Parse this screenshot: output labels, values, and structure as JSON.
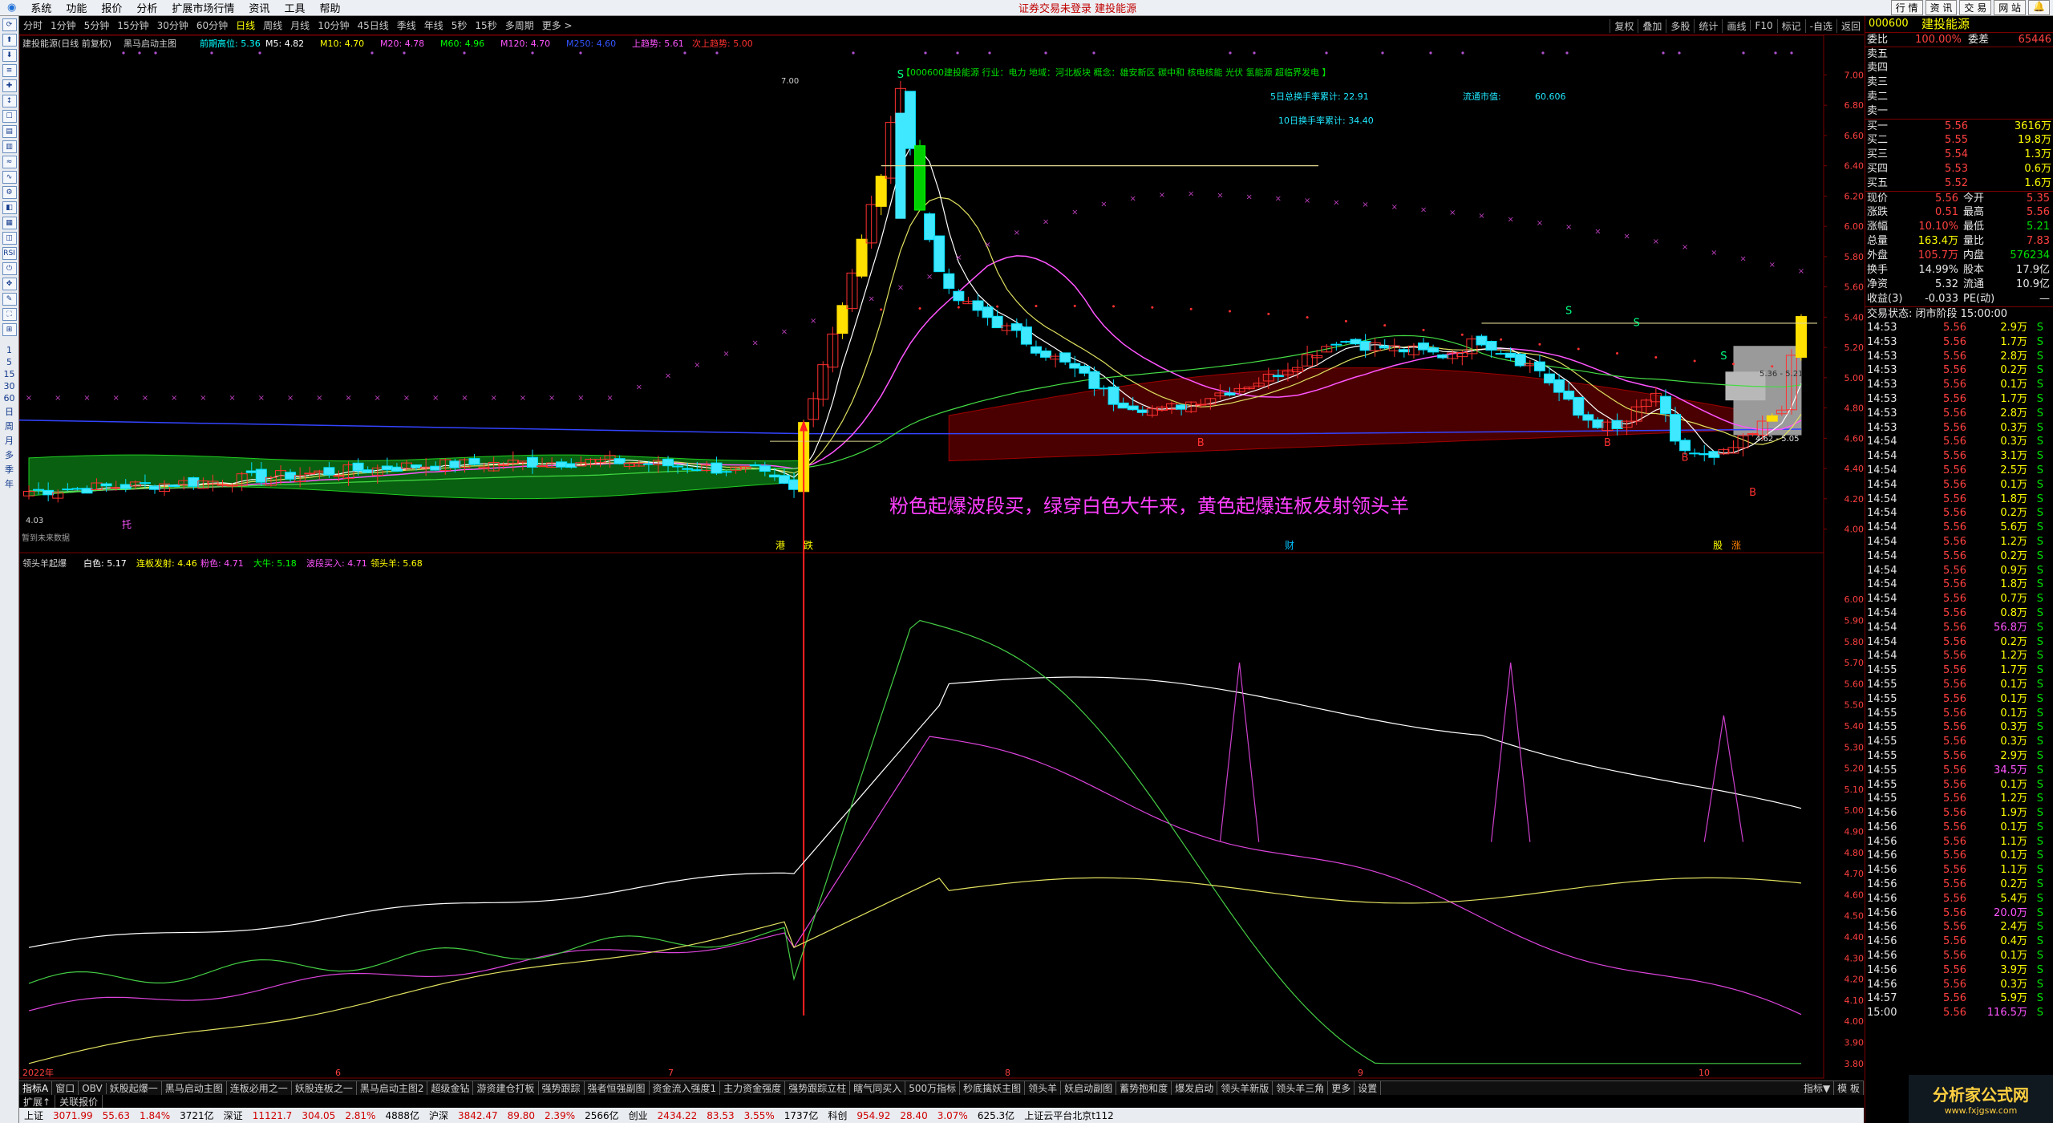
{
  "menu": {
    "items": [
      "系统",
      "功能",
      "报价",
      "分析",
      "扩展市场行情",
      "资讯",
      "工具",
      "帮助"
    ],
    "notice": "证券交易未登录  建投能源",
    "right_buttons": [
      "行 情",
      "资 讯",
      "交 易",
      "网 站",
      "🔔"
    ]
  },
  "periods": [
    "分时",
    "1分钟",
    "5分钟",
    "15分钟",
    "30分钟",
    "60分钟",
    "日线",
    "周线",
    "月线",
    "10分钟",
    "45日线",
    "季线",
    "年线",
    "5秒",
    "15秒",
    "多周期",
    "更多 >"
  ],
  "period_selected": 6,
  "period_right": [
    "复权",
    "叠加",
    "多股",
    "统计",
    "画线",
    "F10",
    "标记",
    "-自选",
    "返回"
  ],
  "left_tools": [
    "⟳",
    "⬆",
    "⬇",
    "≡",
    "✚",
    "↕",
    "☐",
    "▤",
    "▥",
    "≈",
    "∿",
    "⚙",
    "◧",
    "▦",
    "◫",
    "RSI",
    "⏻",
    "✥",
    "✎",
    "⛶",
    "⊞"
  ],
  "left_tabs": [
    "1",
    "5",
    "15",
    "30",
    "60",
    "日",
    "周",
    "月",
    "多",
    "季",
    "年"
  ],
  "main_legend": {
    "title": "建投能源(日线 前复权)",
    "indicator": "黑马启动主图",
    "items": [
      {
        "label": "前期高位: 5.36",
        "color": "#00ffff"
      },
      {
        "label": "M5: 4.82",
        "color": "#ffffff"
      },
      {
        "label": "M10: 4.70",
        "color": "#ffff00"
      },
      {
        "label": "M20: 4.78",
        "color": "#ff55ff"
      },
      {
        "label": "M60: 4.96",
        "color": "#00ff00"
      },
      {
        "label": "M120: 4.70",
        "color": "#ff55ff"
      },
      {
        "label": "M250: 4.60",
        "color": "#3355ff"
      },
      {
        "label": "上趋势: 5.61",
        "color": "#ff55ff"
      },
      {
        "label": "次上趋势: 5.00",
        "color": "#ff3030"
      }
    ]
  },
  "sub_legend": {
    "name": "领头羊起爆",
    "items": [
      {
        "label": "白色: 5.17",
        "color": "#ffffff"
      },
      {
        "label": "连板发射: 4.46",
        "color": "#ffff00"
      },
      {
        "label": "粉色: 4.71",
        "color": "#ff55ff"
      },
      {
        "label": "大牛: 5.18",
        "color": "#00ff00"
      },
      {
        "label": "波段买入: 4.71",
        "color": "#ff55ff"
      },
      {
        "label": "领头羊: 5.68",
        "color": "#ffff00"
      }
    ]
  },
  "info": {
    "line1": "【000600建投能源  行业：电力  地域：河北板块  概念：雄安新区 碳中和 核电核能 光伏 氢能源 超临界发电 】",
    "line2": "5日总换手率累计: 22.91",
    "line3": "流通市值:",
    "line3v": "60.606",
    "line4": "10日换手率累计: 34.40"
  },
  "slogan": "粉色起爆波段买，绿穿白色大牛来，黄色起爆连板发射领头羊",
  "main_labels": {
    "high": "7.00",
    "low": "4.03",
    "tuo": "托",
    "zan": "暂到未来数据",
    "box_top": "5.36 - 5.21",
    "box_bot": "4.62 - 5.05"
  },
  "main_y": [
    "7.00",
    "6.80",
    "6.60",
    "6.40",
    "6.20",
    "6.00",
    "5.80",
    "5.60",
    "5.40",
    "5.20",
    "5.00",
    "4.80",
    "4.60",
    "4.40",
    "4.20",
    "4.00"
  ],
  "sub_y": [
    "6.00",
    "5.90",
    "5.80",
    "5.70",
    "5.60",
    "5.50",
    "5.40",
    "5.30",
    "5.20",
    "5.10",
    "5.00",
    "4.90",
    "4.80",
    "4.70",
    "4.60",
    "4.50",
    "4.40",
    "4.30",
    "4.20",
    "4.10",
    "4.00",
    "3.90",
    "3.80"
  ],
  "x_labels": [
    "2022年",
    "6",
    "7",
    "8",
    "9",
    "10"
  ],
  "event_tags": [
    {
      "t": "港",
      "c": "#ffff00"
    },
    {
      "t": "跌",
      "c": "#ffff00"
    },
    {
      "t": "财",
      "c": "#00c0ff"
    },
    {
      "t": "股",
      "c": "#ffff00"
    },
    {
      "t": "涨",
      "c": "#ff8000"
    }
  ],
  "bottom_tabs": [
    "指标A",
    "窗口",
    "OBV",
    "妖股起爆一",
    "黑马启动主图",
    "连板必用之一",
    "妖股连板之一",
    "黑马启动主图2",
    "超级金钻",
    "游资建仓打板",
    "强势跟踪",
    "强者恒强副图",
    "资金流入强度1",
    "主力资金强度",
    "强势跟踪立柱",
    "瞎气同买入",
    "500万指标",
    "秒底擒妖主图",
    "领头羊",
    "妖启动副图",
    "蓄势抱和度",
    "爆发启动",
    "领头羊新版",
    "领头羊三角",
    "更多",
    "设置"
  ],
  "bottom_tabs_right": [
    "指标▼",
    "模 板"
  ],
  "sub_tabs": [
    "扩展↑",
    "关联报价"
  ],
  "status": [
    {
      "t": "上证",
      "c": ""
    },
    {
      "t": "3071.99",
      "c": "up"
    },
    {
      "t": "55.63",
      "c": "up"
    },
    {
      "t": "1.84%",
      "c": "up"
    },
    {
      "t": "3721亿",
      "c": ""
    },
    {
      "t": "深证",
      "c": ""
    },
    {
      "t": "11121.7",
      "c": "up"
    },
    {
      "t": "304.05",
      "c": "up"
    },
    {
      "t": "2.81%",
      "c": "up"
    },
    {
      "t": "4888亿",
      "c": ""
    },
    {
      "t": "沪深",
      "c": ""
    },
    {
      "t": "3842.47",
      "c": "up"
    },
    {
      "t": "89.80",
      "c": "up"
    },
    {
      "t": "2.39%",
      "c": "up"
    },
    {
      "t": "2566亿",
      "c": ""
    },
    {
      "t": "创业",
      "c": ""
    },
    {
      "t": "2434.22",
      "c": "up"
    },
    {
      "t": "83.53",
      "c": "up"
    },
    {
      "t": "3.55%",
      "c": "up"
    },
    {
      "t": "1737亿",
      "c": ""
    },
    {
      "t": "科创",
      "c": ""
    },
    {
      "t": "954.92",
      "c": "up"
    },
    {
      "t": "28.40",
      "c": "up"
    },
    {
      "t": "3.07%",
      "c": "up"
    },
    {
      "t": "625.3亿",
      "c": ""
    },
    {
      "t": "上证云平台北京t112",
      "c": ""
    }
  ],
  "quote": {
    "code": "000600",
    "name": "建投能源",
    "weibi_label": "委比",
    "weibi": "100.00%",
    "weicha_label": "委差",
    "weicha": "65446",
    "sell": [
      {
        "l": "卖五",
        "p": "",
        "v": ""
      },
      {
        "l": "卖四",
        "p": "",
        "v": ""
      },
      {
        "l": "卖三",
        "p": "",
        "v": ""
      },
      {
        "l": "卖二",
        "p": "",
        "v": ""
      },
      {
        "l": "卖一",
        "p": "",
        "v": ""
      }
    ],
    "buy": [
      {
        "l": "买一",
        "p": "5.56",
        "v": "3616万"
      },
      {
        "l": "买二",
        "p": "5.55",
        "v": "19.8万"
      },
      {
        "l": "买三",
        "p": "5.54",
        "v": "1.3万"
      },
      {
        "l": "买四",
        "p": "5.53",
        "v": "0.6万"
      },
      {
        "l": "买五",
        "p": "5.52",
        "v": "1.6万"
      }
    ],
    "stats": [
      [
        "现价",
        "5.56",
        "今开",
        "5.35"
      ],
      [
        "涨跌",
        "0.51",
        "最高",
        "5.56"
      ],
      [
        "涨幅",
        "10.10%",
        "最低",
        "5.21"
      ],
      [
        "总量",
        "163.4万",
        "量比",
        "7.83"
      ],
      [
        "外盘",
        "105.7万",
        "内盘",
        "576234"
      ],
      [
        "换手",
        "14.99%",
        "股本",
        "17.9亿"
      ],
      [
        "净资",
        "5.32",
        "流通",
        "10.9亿"
      ],
      [
        "收益(3)",
        "-0.033",
        "PE(动)",
        "—"
      ]
    ],
    "trade_state": "交易状态: 闭市阶段 15:00:00",
    "ticks": [
      [
        "14:53",
        "5.56",
        "2.9万"
      ],
      [
        "14:53",
        "5.56",
        "1.7万"
      ],
      [
        "14:53",
        "5.56",
        "2.8万"
      ],
      [
        "14:53",
        "5.56",
        "0.2万"
      ],
      [
        "14:53",
        "5.56",
        "0.1万"
      ],
      [
        "14:53",
        "5.56",
        "1.7万"
      ],
      [
        "14:53",
        "5.56",
        "2.8万"
      ],
      [
        "14:53",
        "5.56",
        "0.3万"
      ],
      [
        "14:54",
        "5.56",
        "0.3万"
      ],
      [
        "14:54",
        "5.56",
        "3.1万"
      ],
      [
        "14:54",
        "5.56",
        "2.5万"
      ],
      [
        "14:54",
        "5.56",
        "0.1万"
      ],
      [
        "14:54",
        "5.56",
        "1.8万"
      ],
      [
        "14:54",
        "5.56",
        "0.2万"
      ],
      [
        "14:54",
        "5.56",
        "5.6万"
      ],
      [
        "14:54",
        "5.56",
        "1.2万"
      ],
      [
        "14:54",
        "5.56",
        "0.2万"
      ],
      [
        "14:54",
        "5.56",
        "0.9万"
      ],
      [
        "14:54",
        "5.56",
        "1.8万"
      ],
      [
        "14:54",
        "5.56",
        "0.7万"
      ],
      [
        "14:54",
        "5.56",
        "0.8万"
      ],
      [
        "14:54",
        "5.56",
        "56.8万"
      ],
      [
        "14:54",
        "5.56",
        "0.2万"
      ],
      [
        "14:54",
        "5.56",
        "1.2万"
      ],
      [
        "14:55",
        "5.56",
        "1.7万"
      ],
      [
        "14:55",
        "5.56",
        "0.1万"
      ],
      [
        "14:55",
        "5.56",
        "0.1万"
      ],
      [
        "14:55",
        "5.56",
        "0.1万"
      ],
      [
        "14:55",
        "5.56",
        "0.3万"
      ],
      [
        "14:55",
        "5.56",
        "0.3万"
      ],
      [
        "14:55",
        "5.56",
        "2.9万"
      ],
      [
        "14:55",
        "5.56",
        "34.5万"
      ],
      [
        "14:55",
        "5.56",
        "0.1万"
      ],
      [
        "14:55",
        "5.56",
        "1.2万"
      ],
      [
        "14:56",
        "5.56",
        "1.9万"
      ],
      [
        "14:56",
        "5.56",
        "0.1万"
      ],
      [
        "14:56",
        "5.56",
        "1.1万"
      ],
      [
        "14:56",
        "5.56",
        "0.1万"
      ],
      [
        "14:56",
        "5.56",
        "1.1万"
      ],
      [
        "14:56",
        "5.56",
        "0.2万"
      ],
      [
        "14:56",
        "5.56",
        "5.4万"
      ],
      [
        "14:56",
        "5.56",
        "20.0万"
      ],
      [
        "14:56",
        "5.56",
        "2.4万"
      ],
      [
        "14:56",
        "5.56",
        "0.4万"
      ],
      [
        "14:56",
        "5.56",
        "0.1万"
      ],
      [
        "14:56",
        "5.56",
        "3.9万"
      ],
      [
        "14:56",
        "5.56",
        "0.3万"
      ],
      [
        "14:57",
        "5.56",
        "5.9万"
      ],
      [
        "15:00",
        "5.56",
        "116.5万"
      ]
    ]
  },
  "logo": {
    "t1": "分析家公式网",
    "t2": "www.fxjgsw.com"
  }
}
